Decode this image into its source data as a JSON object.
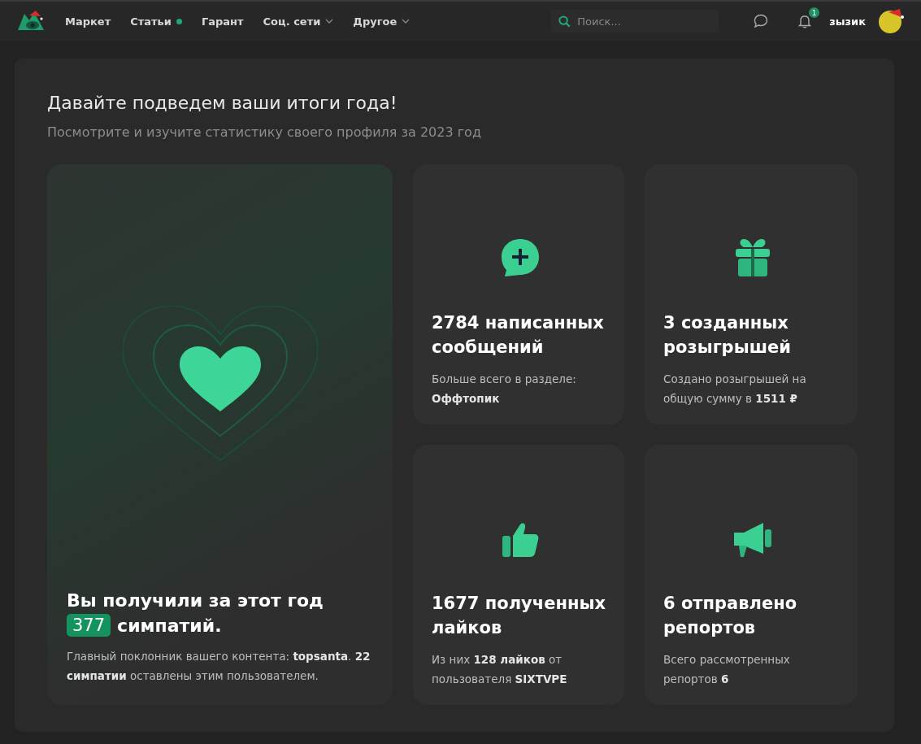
{
  "header": {
    "nav": [
      {
        "label": "Маркет",
        "dot": false,
        "dropdown": false
      },
      {
        "label": "Статьи",
        "dot": true,
        "dropdown": false
      },
      {
        "label": "Гарант",
        "dot": false,
        "dropdown": false
      },
      {
        "label": "Соц. сети",
        "dot": false,
        "dropdown": true
      },
      {
        "label": "Другое",
        "dot": false,
        "dropdown": true
      }
    ],
    "search": {
      "placeholder": "Поиск..."
    },
    "notifications": "1",
    "username": "зызик"
  },
  "page": {
    "title": "Давайте подведем ваши итоги года!",
    "subtitle": "Посмотрите и изучите статистику своего профиля за 2023 год"
  },
  "main_card": {
    "title_before": "Вы получили за этот год",
    "count": "377",
    "title_after": "симпатий.",
    "description": "Главный поклонник вашего контента: **topsanta**. **22 симпатии** оставлены этим пользователем."
  },
  "cards": [
    {
      "kind": "chat",
      "title": "2784 написанных сообщений",
      "description": "Больше всего в разделе: **Оффтопик**"
    },
    {
      "kind": "gift",
      "title": "3 созданных розыгрышей",
      "description": "Создано розыгрышей на общую сумму в **1511 ₽**"
    },
    {
      "kind": "like",
      "title": "1677 полученных лайков",
      "description": "Из них **128 лайков** от пользователя **SIXTVPE**"
    },
    {
      "kind": "megaphone",
      "title": "6 отправлено репортов",
      "description": "Всего рассмотренных репортов **6**"
    }
  ]
}
